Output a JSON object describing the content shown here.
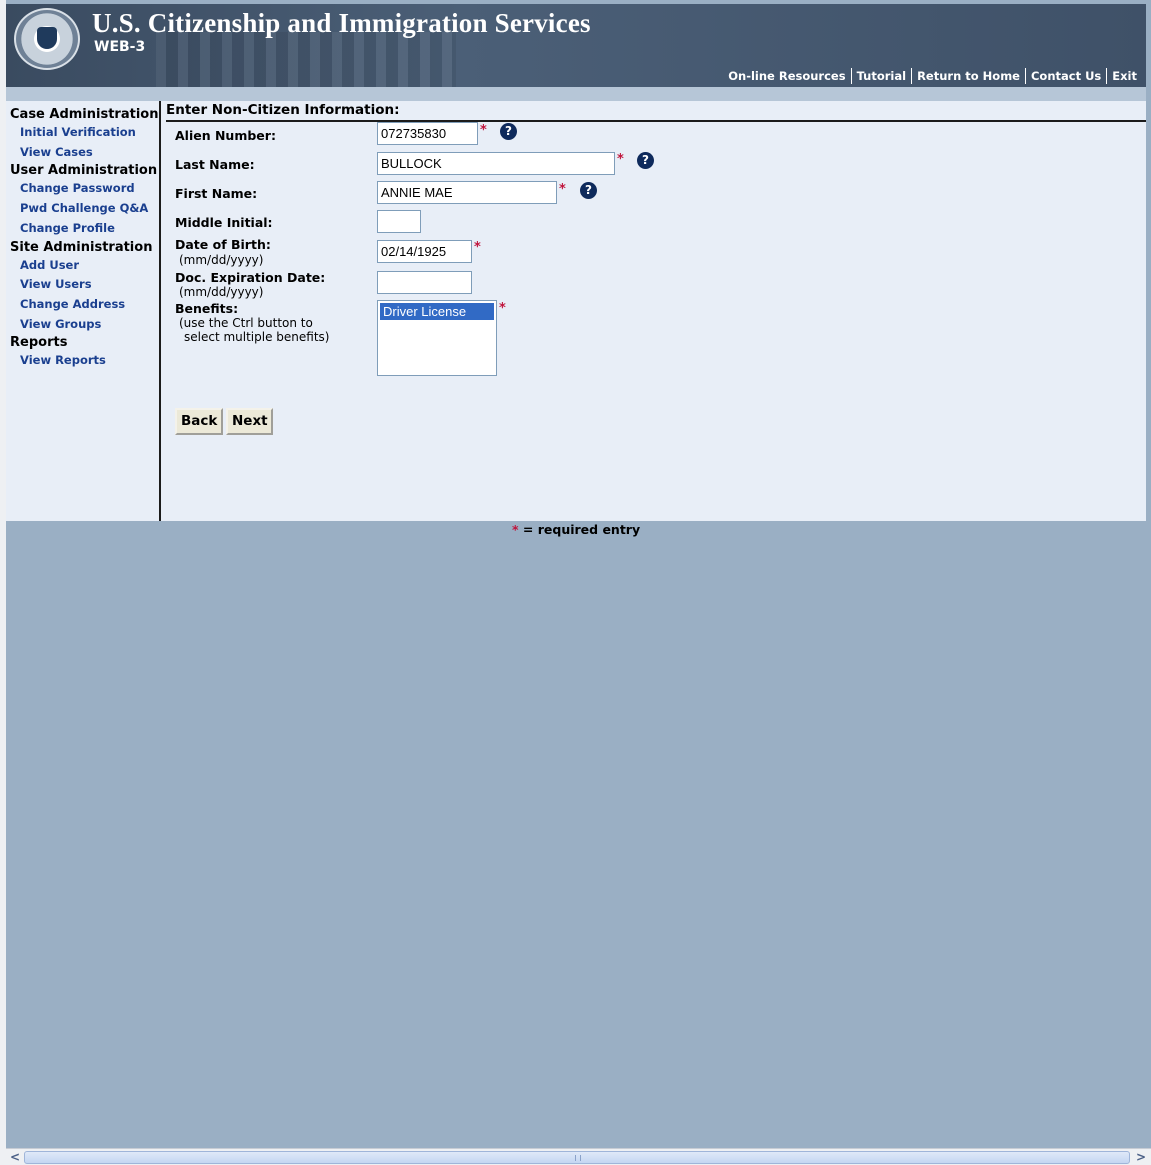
{
  "header": {
    "title": "U.S. Citizenship and Immigration Services",
    "subtitle": "WEB-3",
    "links": [
      "On-line Resources",
      "Tutorial",
      "Return to Home",
      "Contact Us",
      "Exit"
    ]
  },
  "sidebar": {
    "sections": [
      {
        "title": "Case Administration",
        "items": [
          "Initial Verification",
          "View Cases"
        ]
      },
      {
        "title": "User Administration",
        "items": [
          "Change Password",
          "Pwd Challenge Q&A",
          "Change Profile"
        ]
      },
      {
        "title": "Site Administration",
        "items": [
          "Add User",
          "View Users",
          "Change Address",
          "View Groups"
        ]
      },
      {
        "title": "Reports",
        "items": [
          "View Reports"
        ]
      }
    ]
  },
  "form": {
    "title": "Enter Non-Citizen Information:",
    "alien_number": {
      "label": "Alien Number:",
      "value": "072735830"
    },
    "last_name": {
      "label": "Last Name:",
      "value": "BULLOCK"
    },
    "first_name": {
      "label": "First Name:",
      "value": "ANNIE MAE"
    },
    "middle_initial": {
      "label": "Middle Initial:",
      "value": ""
    },
    "date_of_birth": {
      "label": "Date of Birth:",
      "hint": "(mm/dd/yyyy)",
      "value": "02/14/1925"
    },
    "doc_expiration": {
      "label": "Doc. Expiration Date:",
      "hint": "(mm/dd/yyyy)",
      "value": ""
    },
    "benefits": {
      "label": "Benefits:",
      "hint_line1": "(use the Ctrl button to",
      "hint_line2": "select multiple benefits)",
      "options": [
        "Driver License"
      ]
    },
    "required_marker": "*",
    "help_glyph": "?",
    "back_label": "Back",
    "next_label": "Next"
  },
  "footer": {
    "required_star": "*",
    "required_text": "= required entry"
  },
  "scrollbar": {
    "left_arrow": "<",
    "right_arrow": ">"
  },
  "colors": {
    "header_bg": "#3f5168",
    "content_bg": "#e8eef7",
    "page_bg": "#9aafc4",
    "nav_link": "#1a3f8f",
    "required": "#c0143c",
    "selected_option": "#316ac5"
  },
  "icons": [
    "dhs-seal-icon",
    "help-icon",
    "required-asterisk-icon"
  ]
}
